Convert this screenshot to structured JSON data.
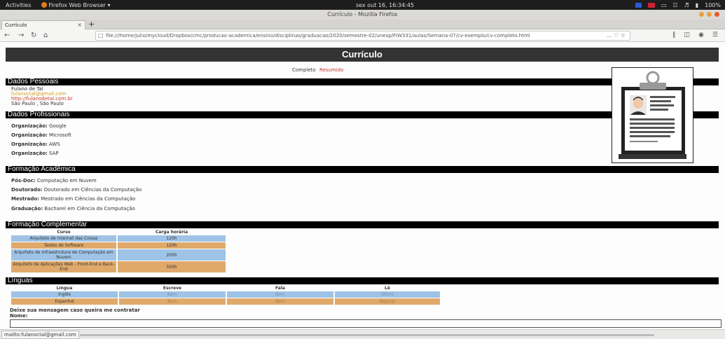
{
  "system": {
    "activities": "Activities",
    "app_menu": "Firefox Web Browser ▾",
    "clock": "sex out 16, 16:34:45",
    "battery": "100%"
  },
  "window": {
    "title": "Currículo - Mozilla Firefox"
  },
  "tabs": [
    {
      "label": "Currículo",
      "close": "×"
    }
  ],
  "new_tab": "+",
  "nav": {
    "url": "file:///home/julio/mycloud/Dropbox/cmc/producao-academica/ensino/disciplinas/graduacao/2020/semestre-02/unesp/FIW331/aulas/Semana-07/cv-exemplo/cv-completo.html",
    "url_actions": "… ♡ ☆"
  },
  "page": {
    "title": "Currículo",
    "mode_current": "Completo",
    "mode_alt": "Resumido",
    "personal": {
      "heading": "Dados Pessoais",
      "name": "Fulano de Tal",
      "email": "fulanoctal@gmail.com",
      "site": "http://fulanodetal.com.br",
      "city": "São Paulo , São Paulo"
    },
    "professional": {
      "heading": "Dados Profissionais",
      "label": "Organização:",
      "orgs": [
        "Google",
        "Microsoft",
        "AWS",
        "SAP"
      ]
    },
    "academic": {
      "heading": "Formação Acadêmica",
      "items": [
        {
          "level": "Pós-Doc:",
          "course": "Computação em Nuvem"
        },
        {
          "level": "Doutorado:",
          "course": "Doutorado em Ciências da Computação"
        },
        {
          "level": "Mestrado:",
          "course": "Mestrado em Ciências da Computação"
        },
        {
          "level": "Graduação:",
          "course": "Bacharel em Ciência da Computação"
        }
      ]
    },
    "complementary": {
      "heading": "Formação Complementar",
      "headers": [
        "Curso",
        "Carga horária"
      ],
      "rows": [
        [
          "Arquiteto de Internet das Coisas",
          "120h"
        ],
        [
          "Testes de Software",
          "120h"
        ],
        [
          "Arquiteto de Infraestrutura de Computação em Nuvem",
          "200h"
        ],
        [
          "Arquiteto de Aplicações Web - Front-End e Back-End",
          "500h"
        ]
      ]
    },
    "languages": {
      "heading": "Línguas",
      "headers": [
        "Língua",
        "Escreve",
        "Fala",
        "Lê"
      ],
      "rows": [
        [
          "Inglês",
          "Bem",
          "Bem",
          "Ótimo"
        ],
        [
          "Espanhol",
          "Bem",
          "Bem",
          "Regular"
        ]
      ]
    },
    "message": {
      "prompt": "Deixe sua mensagem caso queira me contratar",
      "name_label": "Nome:"
    }
  },
  "status": {
    "hover_url": "mailto:fulanoctal@gmail.com"
  },
  "colors": {
    "row_blue": "#9ec3e6",
    "row_orange": "#e0a96a",
    "bar": "#333333",
    "link": "#c0392b"
  }
}
